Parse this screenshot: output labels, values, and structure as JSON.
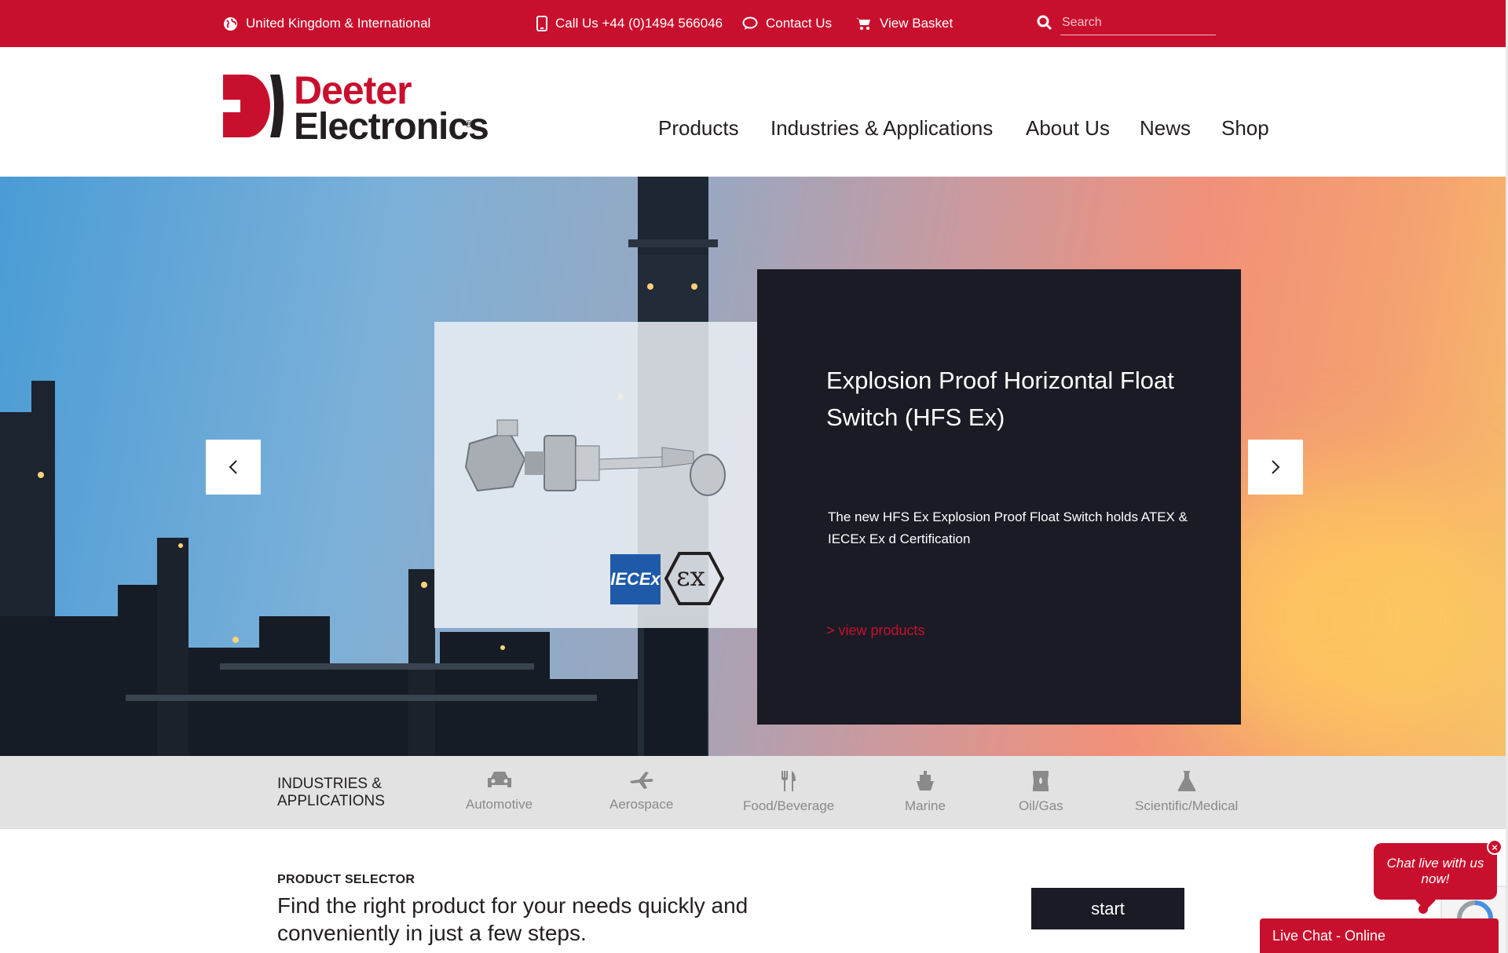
{
  "colors": {
    "brand_red": "#c8102e",
    "dark_navy": "#1a1b25",
    "industries_bg": "#e2e2e2"
  },
  "topbar": {
    "region": "United Kingdom & International",
    "phone": "Call Us +44 (0)1494 566046",
    "contact": "Contact Us",
    "basket": "View Basket",
    "search_placeholder": "Search"
  },
  "logo": {
    "line1": "Deeter",
    "line2": "Electronics",
    "reg": "®"
  },
  "nav": {
    "items": [
      "Products",
      "Industries & Applications",
      "About Us",
      "News",
      "Shop"
    ]
  },
  "hero": {
    "title": "Explosion Proof Horizontal Float Switch (HFS Ex)",
    "description": "The new HFS Ex Explosion Proof Float Switch holds ATEX & IECEx Ex d Certification",
    "link": "> view products",
    "badge_iecex": "IECEx",
    "badge_ex": "εx",
    "prev_icon": "chevron-left-icon",
    "next_icon": "chevron-right-icon"
  },
  "industries": {
    "heading_line1": "INDUSTRIES &",
    "heading_line2": "APPLICATIONS",
    "items": [
      {
        "label": "Automotive",
        "icon": "car-icon"
      },
      {
        "label": "Aerospace",
        "icon": "plane-icon"
      },
      {
        "label": "Food/Beverage",
        "icon": "fork-knife-icon"
      },
      {
        "label": "Marine",
        "icon": "ship-icon"
      },
      {
        "label": "Oil/Gas",
        "icon": "oil-barrel-icon"
      },
      {
        "label": "Scientific/Medical",
        "icon": "flask-icon"
      }
    ]
  },
  "product_selector": {
    "label": "PRODUCT SELECTOR",
    "text": "Find the right product for your needs quickly and conveniently in just a few steps.",
    "button": "start"
  },
  "chat": {
    "bubble": "Chat live with us now!",
    "bar": "Live Chat - Online"
  }
}
